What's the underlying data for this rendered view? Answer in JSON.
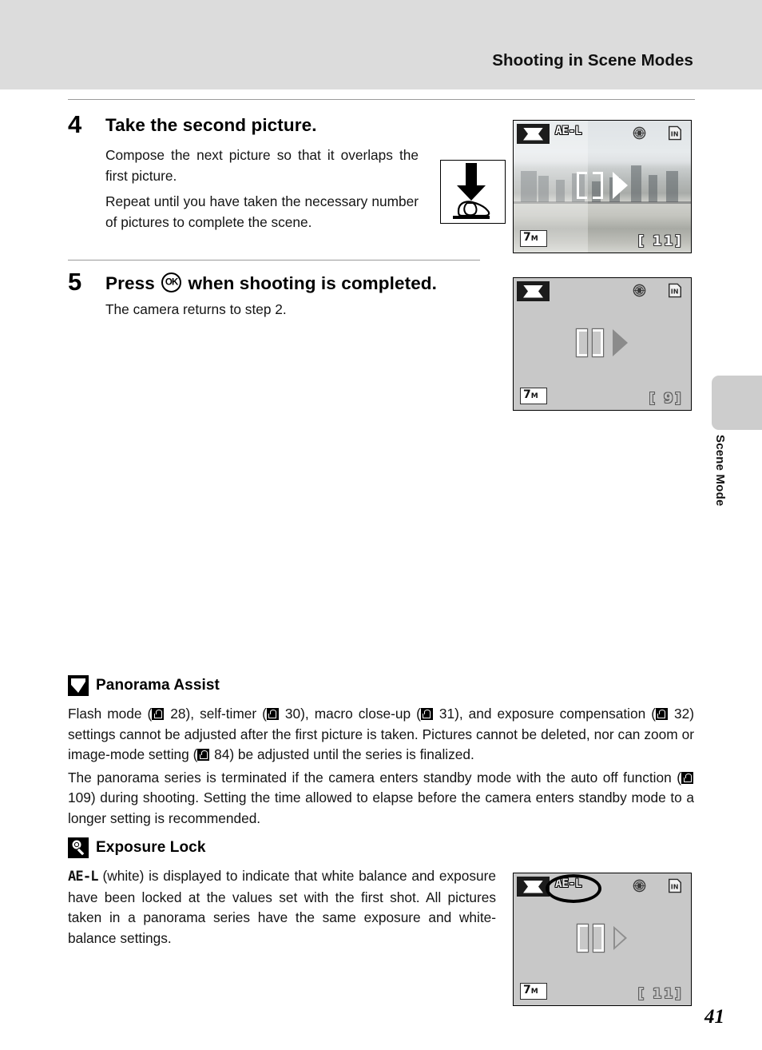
{
  "header": {
    "title": "Shooting in Scene Modes"
  },
  "side_tab": {
    "label": "Scene Mode"
  },
  "steps": [
    {
      "number": "4",
      "title": "Take the second picture.",
      "paragraphs": [
        "Compose the next picture so that it overlaps the first picture.",
        "Repeat until you have taken the necessary number of pictures to complete the scene."
      ]
    },
    {
      "number": "5",
      "title_before": "Press",
      "title_icon": "OK",
      "title_after": "when shooting is completed.",
      "paragraphs": [
        "The camera returns to step 2."
      ]
    }
  ],
  "screens": {
    "screen1": {
      "mode_icon": "panorama-assist-icon",
      "ae_lock_label": "AE-L",
      "battery_icon": "battery-icon",
      "memory_icon": "internal-memory-icon",
      "image_size": "7",
      "image_size_unit": "M",
      "shots_remaining": "11",
      "focus_indicator": "focus-brackets",
      "direction_indicator": "right-arrow-icon"
    },
    "screen2": {
      "mode_icon": "panorama-assist-icon",
      "battery_icon": "battery-icon",
      "memory_icon": "internal-memory-icon",
      "image_size": "7",
      "image_size_unit": "M",
      "shots_remaining": "9",
      "focus_indicator": "focus-brackets",
      "direction_indicator": "right-arrow-icon"
    },
    "screen3": {
      "mode_icon": "panorama-assist-icon",
      "ae_lock_label": "AE-L",
      "battery_icon": "battery-icon",
      "memory_icon": "internal-memory-icon",
      "image_size": "7",
      "image_size_unit": "M",
      "shots_remaining": "11",
      "focus_indicator": "focus-brackets",
      "direction_indicator": "right-arrow-icon",
      "highlight": "ae-lock-highlight-ellipse"
    }
  },
  "notes": [
    {
      "icon": "caution-checkmark-icon",
      "title": "Panorama Assist",
      "paragraph1_a": "Flash mode (",
      "paragraph1_b": "28), self-timer (",
      "paragraph1_c": "30), macro close-up (",
      "paragraph1_d": "31), and exposure compensation (",
      "paragraph1_e": "32) settings cannot be adjusted after the first picture is taken. Pictures cannot be deleted, nor can zoom or image-mode setting (",
      "paragraph1_f": "84) be adjusted until the series is finalized.",
      "paragraph2_a": "The panorama series is terminated if the camera enters standby mode with the auto off function (",
      "paragraph2_b": "109) during shooting. Setting the time allowed to elapse before the camera enters standby mode to a longer setting is recommended.",
      "page_refs": [
        "28",
        "30",
        "31",
        "32",
        "84",
        "109"
      ]
    },
    {
      "icon": "tip-lightbulb-icon",
      "title": "Exposure Lock",
      "ael_label": "AE-L",
      "paragraph1": "(white) is displayed to indicate that white balance and exposure have been locked at the values set with the first shot. All pictures taken in a panorama series have the same exposure and white-balance settings."
    }
  ],
  "footer": {
    "page_number": "41"
  }
}
